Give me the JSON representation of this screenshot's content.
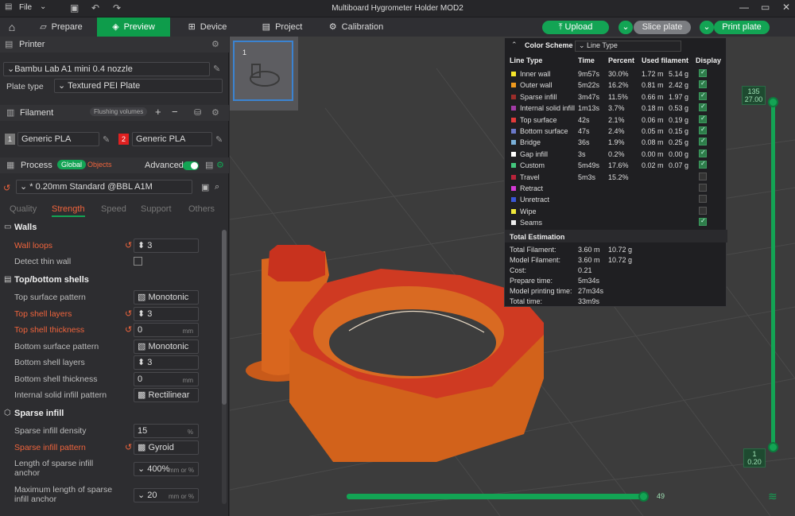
{
  "titlebar": {
    "file": "File",
    "title": "Multiboard Hygrometer Holder MOD2"
  },
  "tabs": {
    "prepare": "Prepare",
    "preview": "Preview",
    "device": "Device",
    "project": "Project",
    "calibration": "Calibration"
  },
  "actions": {
    "upload": "Upload",
    "slice": "Slice plate",
    "print": "Print plate"
  },
  "printer": {
    "heading": "Printer",
    "name": "Bambu Lab A1 mini 0.4 nozzle",
    "plate_label": "Plate type",
    "plate_value": "Textured PEI Plate"
  },
  "filament": {
    "heading": "Filament",
    "flushing": "Flushing volumes",
    "items": [
      {
        "num": "1",
        "name": "Generic PLA"
      },
      {
        "num": "2",
        "name": "Generic PLA"
      }
    ]
  },
  "process": {
    "heading": "Process",
    "global": "Global",
    "objects": "Objects",
    "advanced": "Advanced",
    "preset": "* 0.20mm Standard @BBL A1M"
  },
  "subtabs": {
    "quality": "Quality",
    "strength": "Strength",
    "speed": "Speed",
    "support": "Support",
    "others": "Others"
  },
  "walls": {
    "heading": "Walls",
    "wall_loops_label": "Wall loops",
    "wall_loops": "3",
    "thin_wall_label": "Detect thin wall"
  },
  "shells": {
    "heading": "Top/bottom shells",
    "top_pattern_label": "Top surface pattern",
    "top_pattern": "Monotonic ...",
    "top_layers_label": "Top shell layers",
    "top_layers": "3",
    "top_thickness_label": "Top shell thickness",
    "top_thickness": "0",
    "unit_mm": "mm",
    "bottom_pattern_label": "Bottom surface pattern",
    "bottom_pattern": "Monotonic",
    "bottom_layers_label": "Bottom shell layers",
    "bottom_layers": "3",
    "bottom_thickness_label": "Bottom shell thickness",
    "bottom_thickness": "0",
    "internal_label": "Internal solid infill pattern",
    "internal": "Rectilinear"
  },
  "sparse": {
    "heading": "Sparse infill",
    "density_label": "Sparse infill density",
    "density": "15",
    "pct": "%",
    "pattern_label": "Sparse infill pattern",
    "pattern": "Gyroid",
    "anchor_label": "Length of sparse infill anchor",
    "anchor": "400%",
    "anchor_unit": "mm or %",
    "max_anchor_label": "Maximum length of sparse infill anchor",
    "max_anchor": "20"
  },
  "legend": {
    "scheme_label": "Color Scheme",
    "scheme_value": "Line Type",
    "headers": [
      "Line Type",
      "Time",
      "Percent",
      "Used filament",
      "Display"
    ],
    "rows": [
      {
        "name": "Inner wall",
        "time": "9m57s",
        "pct": "30.0%",
        "len": "1.72 m",
        "wt": "5.14 g",
        "color": "#f6e52a",
        "on": true
      },
      {
        "name": "Outer wall",
        "time": "5m22s",
        "pct": "16.2%",
        "len": "0.81 m",
        "wt": "2.42 g",
        "color": "#f09a1e",
        "on": true
      },
      {
        "name": "Sparse infill",
        "time": "3m47s",
        "pct": "11.5%",
        "len": "0.66 m",
        "wt": "1.97 g",
        "color": "#9b2d2a",
        "on": true
      },
      {
        "name": "Internal solid infill",
        "time": "1m13s",
        "pct": "3.7%",
        "len": "0.18 m",
        "wt": "0.53 g",
        "color": "#a13ba6",
        "on": true
      },
      {
        "name": "Top surface",
        "time": "42s",
        "pct": "2.1%",
        "len": "0.06 m",
        "wt": "0.19 g",
        "color": "#e23a3a",
        "on": true
      },
      {
        "name": "Bottom surface",
        "time": "47s",
        "pct": "2.4%",
        "len": "0.05 m",
        "wt": "0.15 g",
        "color": "#6a78c8",
        "on": true
      },
      {
        "name": "Bridge",
        "time": "36s",
        "pct": "1.9%",
        "len": "0.08 m",
        "wt": "0.25 g",
        "color": "#7ab0d8",
        "on": true
      },
      {
        "name": "Gap infill",
        "time": "3s",
        "pct": "0.2%",
        "len": "0.00 m",
        "wt": "0.00 g",
        "color": "#ffffff",
        "on": true
      },
      {
        "name": "Custom",
        "time": "5m49s",
        "pct": "17.6%",
        "len": "0.02 m",
        "wt": "0.07 g",
        "color": "#43c77e",
        "on": true
      },
      {
        "name": "Travel",
        "time": "5m3s",
        "pct": "15.2%",
        "len": "",
        "wt": "",
        "color": "#b8233a",
        "on": false
      },
      {
        "name": "Retract",
        "time": "",
        "pct": "",
        "len": "",
        "wt": "",
        "color": "#d43ad4",
        "on": false
      },
      {
        "name": "Unretract",
        "time": "",
        "pct": "",
        "len": "",
        "wt": "",
        "color": "#3a57d8",
        "on": false
      },
      {
        "name": "Wipe",
        "time": "",
        "pct": "",
        "len": "",
        "wt": "",
        "color": "#f0e83a",
        "on": false
      },
      {
        "name": "Seams",
        "time": "",
        "pct": "",
        "len": "",
        "wt": "",
        "color": "#ededed",
        "on": true
      }
    ],
    "total_heading": "Total Estimation",
    "totals": [
      {
        "k": "Total Filament:",
        "a": "3.60 m",
        "b": "10.72 g"
      },
      {
        "k": "Model Filament:",
        "a": "3.60 m",
        "b": "10.72 g"
      },
      {
        "k": "Cost:",
        "a": "0.21",
        "b": ""
      },
      {
        "k": "Prepare time:",
        "a": "5m34s",
        "b": ""
      },
      {
        "k": "Model printing time:",
        "a": "27m34s",
        "b": ""
      },
      {
        "k": "Total time:",
        "a": "33m9s",
        "b": ""
      }
    ]
  },
  "plate": {
    "number": "1"
  },
  "layers": {
    "top_layer": "135",
    "top_height": "27.00",
    "bottom_layer": "1",
    "bottom_height": "0.20",
    "move_value": "49"
  }
}
